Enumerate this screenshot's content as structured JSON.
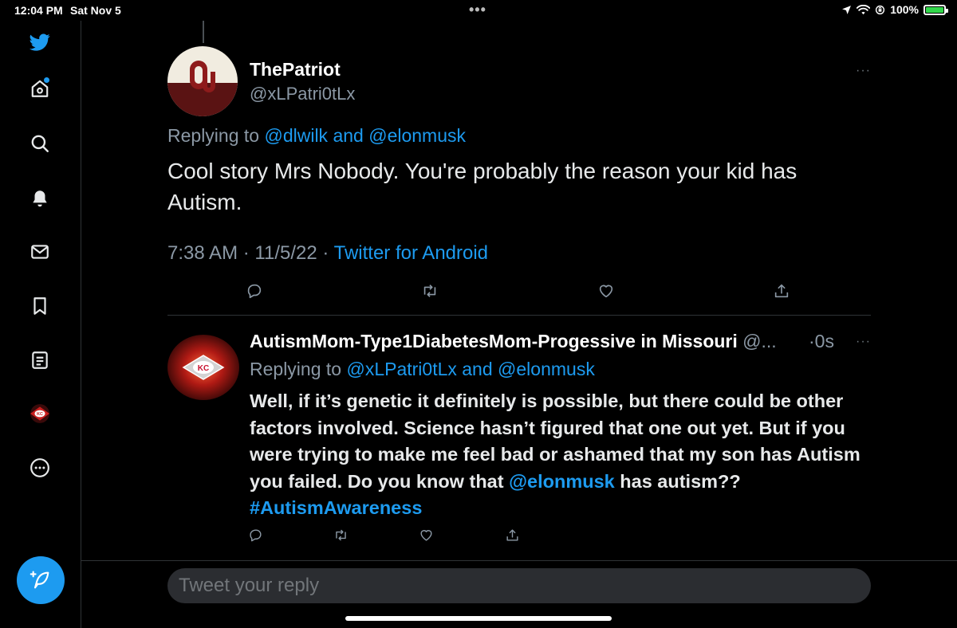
{
  "status_bar": {
    "time": "12:04 PM",
    "date": "Sat Nov 5",
    "dots": "•••",
    "battery": "100%",
    "battery_level": 1.0
  },
  "sidebar": {
    "items": [
      {
        "icon": "twitter-logo-icon"
      },
      {
        "icon": "home-icon"
      },
      {
        "icon": "search-icon"
      },
      {
        "icon": "bell-icon"
      },
      {
        "icon": "mail-icon"
      },
      {
        "icon": "bookmark-icon"
      },
      {
        "icon": "lists-icon"
      },
      {
        "icon": "profile-avatar-icon"
      },
      {
        "icon": "more-circle-icon"
      },
      {
        "icon": "compose-tweet-icon"
      }
    ]
  },
  "main_tweet": {
    "display_name": "ThePatriot",
    "handle": "@xLPatri0tLx",
    "replying_prefix": "Replying to",
    "reply_to_1": "@dlwilk",
    "reply_and": "and",
    "reply_to_2": "@elonmusk",
    "text": "Cool story Mrs Nobody. You're probably the reason your kid has Autism.",
    "time": "7:38 AM",
    "separator": "·",
    "date": "11/5/22",
    "source": "Twitter for Android",
    "more": "···"
  },
  "reply_tweet": {
    "display_name": "AutismMom-Type1DiabetesMom-Progessive in Missouri",
    "handle": "@...",
    "separator": "·",
    "time": "0s",
    "more": "···",
    "replying_prefix": "Replying to",
    "reply_to_1": "@xLPatri0tLx",
    "reply_and": "and",
    "reply_to_2": "@elonmusk",
    "text_part1": "Well, if it’s genetic it definitely is possible, but there could be other factors involved. Science hasn’t figured that one out yet. But if you were trying to make me feel bad or ashamed that my son has Autism you failed. Do you know that ",
    "mention": "@elonmusk",
    "text_part2": " has autism?? ",
    "hashtag": "#AutismAwareness"
  },
  "composer": {
    "placeholder": "Tweet your reply"
  },
  "colors": {
    "background": "#000000",
    "accent": "#1d9bf0",
    "muted": "#8b98a5",
    "divider": "#2f3336"
  }
}
